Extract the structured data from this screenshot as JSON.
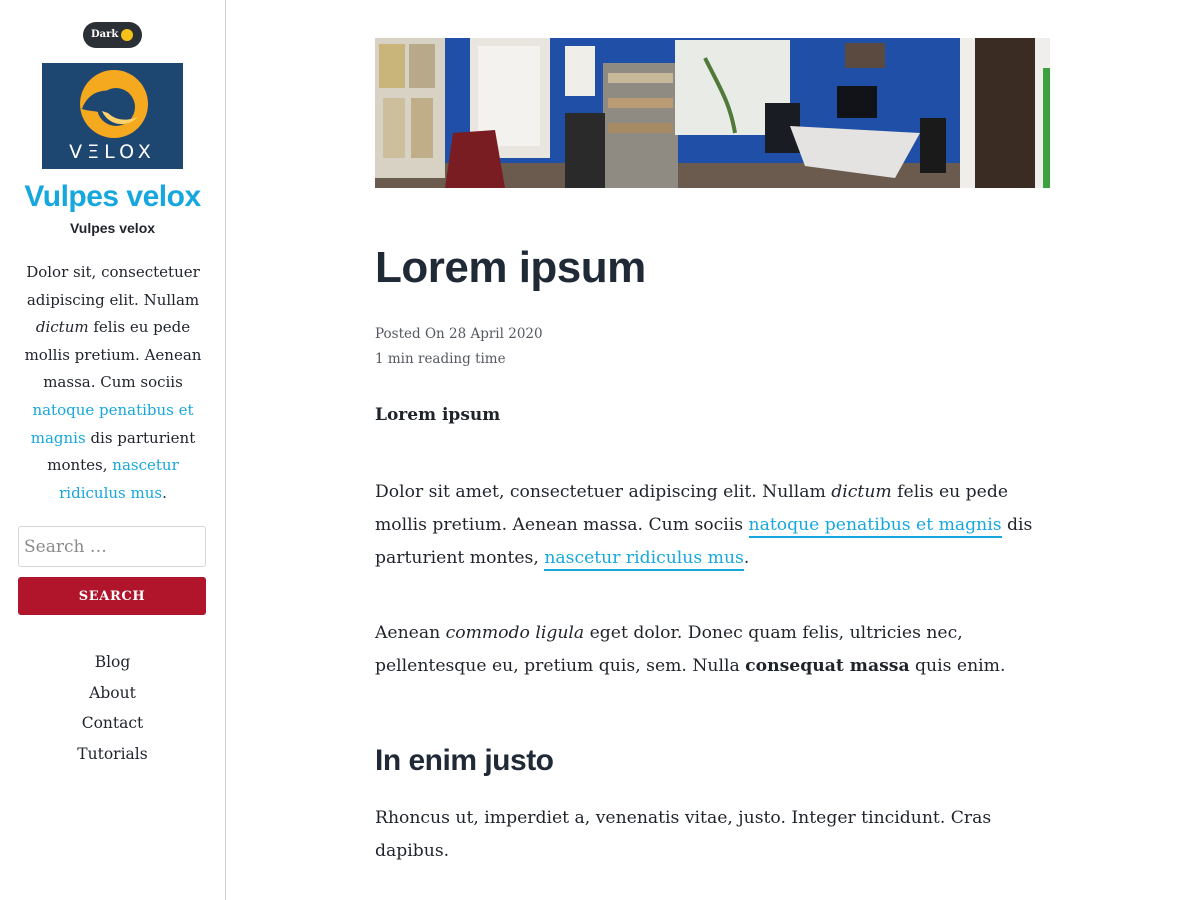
{
  "theme": {
    "accent_link": "#17a7df",
    "search_button": "#b0152b",
    "logo_bg": "#1d4670",
    "toggle_bg": "#2b3036"
  },
  "sidebar": {
    "dark_toggle_label": "Dark",
    "logo_text": "VΞLOX",
    "site_title": "Vulpes velox",
    "site_subtitle": "Vulpes velox",
    "bio": {
      "t1": "Dolor sit, consectetuer adipiscing elit. Nullam ",
      "em": "dictum",
      "t2": " felis eu pede mollis pretium. Aenean massa. Cum sociis ",
      "link1": "natoque penatibus et magnis",
      "t3": " dis parturient montes, ",
      "link2": "nascetur ridiculus mus",
      "t4": "."
    },
    "search": {
      "placeholder": "Search …",
      "button_label": "SEARCH"
    },
    "nav": [
      {
        "label": "Blog"
      },
      {
        "label": "About"
      },
      {
        "label": "Contact"
      },
      {
        "label": "Tutorials"
      }
    ]
  },
  "post": {
    "title": "Lorem ipsum",
    "posted_on": "Posted On 28 April 2020",
    "reading_time": "1 min reading time",
    "lead_heading": "Lorem ipsum",
    "p1": {
      "t1": "Dolor sit amet, consectetuer adipiscing elit. Nullam ",
      "em": "dictum",
      "t2": " felis eu pede mollis pretium. Aenean massa. Cum sociis ",
      "link1": "natoque penatibus et magnis",
      "t3": " dis parturient montes, ",
      "link2": "nascetur ridiculus mus",
      "t4": "."
    },
    "p2": {
      "t1": "Aenean ",
      "em": "commodo ligula",
      "t2": " eget dolor. Donec quam felis, ultricies nec, pellentesque eu, pretium quis, sem. Nulla ",
      "strong": "consequat massa",
      "t3": " quis enim."
    },
    "section_heading": "In enim justo",
    "p3": "Rhoncus ut, imperdiet a, venenatis vitae, justo. Integer tincidunt. Cras dapibus."
  }
}
